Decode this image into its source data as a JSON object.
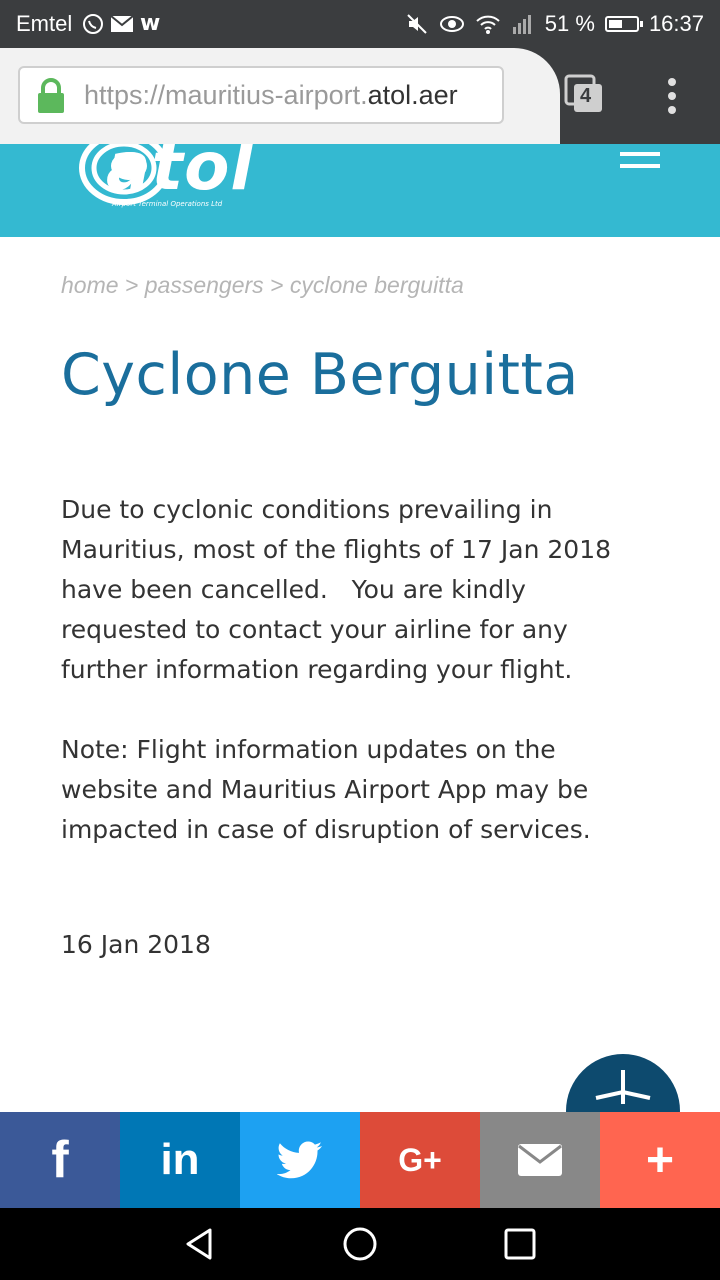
{
  "status_bar": {
    "carrier": "Emtel",
    "battery_text": "51 %",
    "battery_level": 0.51,
    "time": "16:37"
  },
  "browser": {
    "url_prefix": "https://mauritius-airport.",
    "url_domain": "atol.aer",
    "tab_count": "4"
  },
  "site": {
    "logo_text": "atol",
    "logo_subtitle": "Airport Terminal Operations Ltd"
  },
  "breadcrumb": "home > passengers > cyclone berguitta",
  "page": {
    "title": "Cyclone Berguitta",
    "paragraph1": "Due to cyclonic conditions prevailing in\nMauritius, most of the flights of 17 Jan 2018\nhave been cancelled.   You are kindly\nrequested to contact your airline for any\nfurther information regarding your flight.",
    "paragraph2": "Note: Flight information updates on the\nwebsite and Mauritius Airport App may be\nimpacted in case of disruption of services.",
    "date": "16 Jan 2018"
  },
  "share": {
    "facebook": "f",
    "linkedin": "in",
    "googleplus": "G+",
    "more": "+"
  },
  "colors": {
    "header": "#34b9d1",
    "title": "#1a6e9c",
    "facebook": "#3b5998",
    "linkedin": "#0077b5",
    "twitter": "#1da1f2",
    "googleplus": "#dd4b39",
    "email": "#888888",
    "more": "#ff6550"
  }
}
